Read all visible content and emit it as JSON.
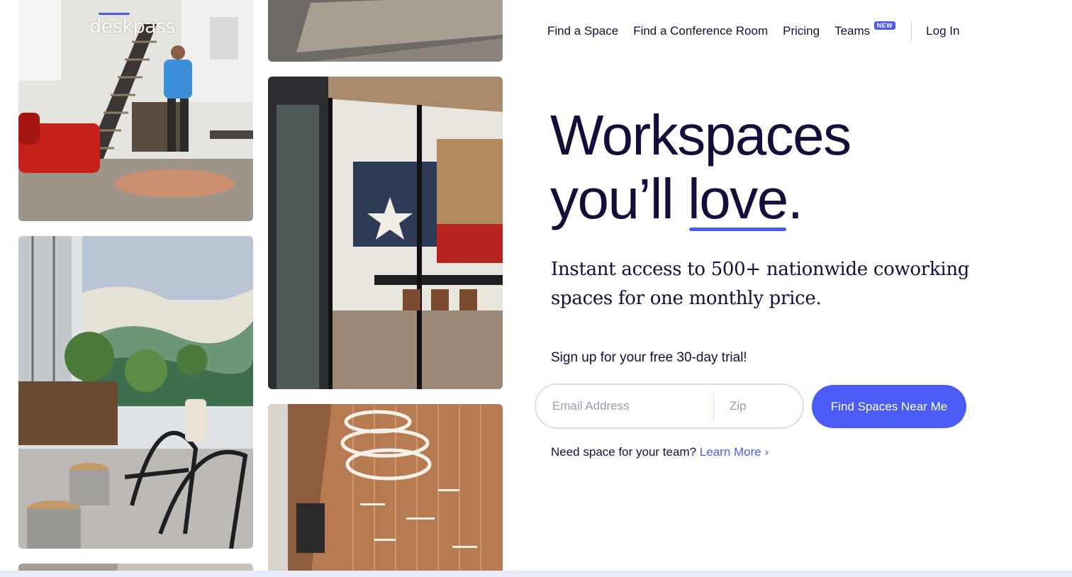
{
  "brand": {
    "logo_text": "deskpass",
    "accent_color": "#4a5cf5",
    "text_color": "#12103a"
  },
  "nav": {
    "items": [
      {
        "label": "Find a Space"
      },
      {
        "label": "Find a Conference Room"
      },
      {
        "label": "Pricing"
      },
      {
        "label": "Teams",
        "badge": "NEW"
      }
    ],
    "login_label": "Log In"
  },
  "hero": {
    "headline_line1": "Workspaces",
    "headline_line2_prefix": "you’ll ",
    "headline_emphasis": "love",
    "headline_suffix": ".",
    "subhead": "Instant access to 500+ nationwide coworking spaces for one monthly price."
  },
  "signup": {
    "label": "Sign up for your free 30-day trial!",
    "email_placeholder": "Email Address",
    "zip_placeholder": "Zip",
    "button_label": "Find Spaces Near Me"
  },
  "team_prompt": {
    "text": "Need space for your team?",
    "link_label": "Learn More",
    "link_icon": "chevron-right-icon"
  },
  "photos": [
    {
      "name": "photo-loft-staircase"
    },
    {
      "name": "photo-wood-table-top"
    },
    {
      "name": "photo-texas-flag-conference-room"
    },
    {
      "name": "photo-plant-lounge-mural"
    },
    {
      "name": "photo-ring-chandelier"
    },
    {
      "name": "photo-bottom-partial"
    }
  ]
}
